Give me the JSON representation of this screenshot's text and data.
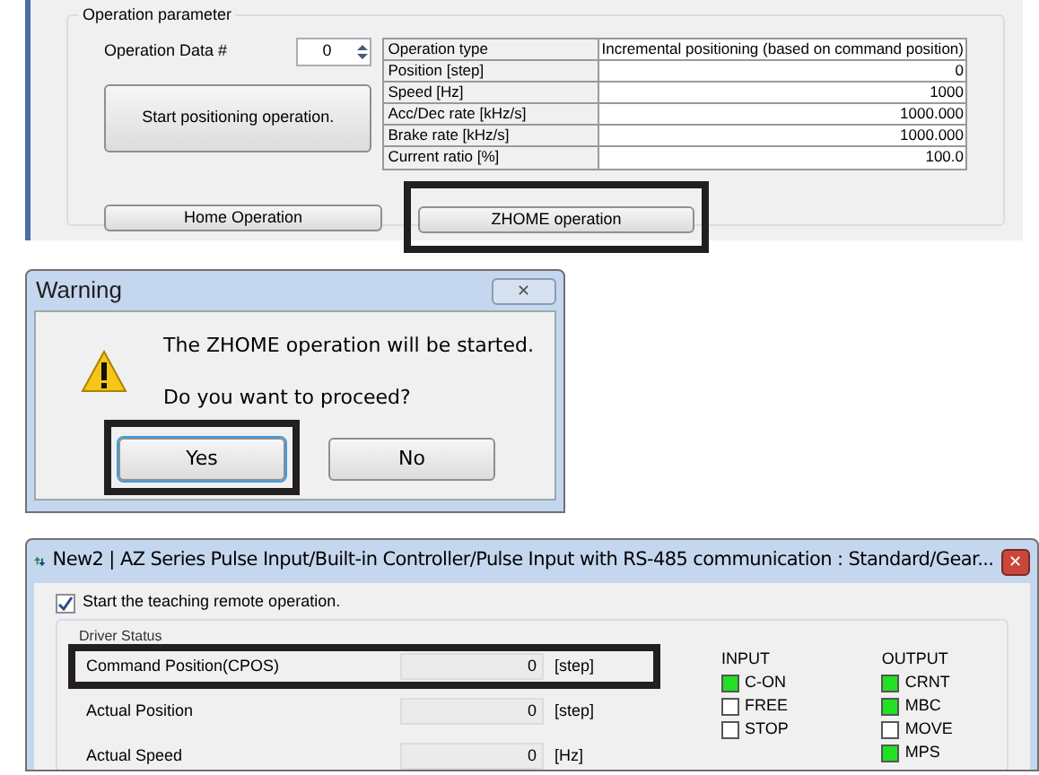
{
  "operation_panel": {
    "group_title": "Operation parameter",
    "data_label": "Operation Data #",
    "data_value": "0",
    "start_button": "Start positioning operation.",
    "home_button": "Home Operation",
    "zhome_button": "ZHOME operation",
    "zhome_highlighted": true,
    "params": [
      {
        "name": "Operation type",
        "value": "Incremental positioning (based on command position)"
      },
      {
        "name": "Position [step]",
        "value": "0"
      },
      {
        "name": "Speed [Hz]",
        "value": "1000"
      },
      {
        "name": "Acc/Dec rate [kHz/s]",
        "value": "1000.000"
      },
      {
        "name": "Brake rate [kHz/s]",
        "value": "1000.000"
      },
      {
        "name": "Current ratio [%]",
        "value": "100.0"
      }
    ]
  },
  "warning_dialog": {
    "title": "Warning",
    "message": "The ZHOME operation will be started.",
    "question": "Do you want to proceed?",
    "close": "✕",
    "buttons": [
      {
        "label": "Yes",
        "selected": true,
        "highlighted": true
      },
      {
        "label": "No",
        "selected": false,
        "highlighted": false
      }
    ]
  },
  "teaching_window": {
    "title": "New2 | AZ Series Pulse Input/Built-in Controller/Pulse Input with RS-485 communication : Standard/Gear...",
    "close": "✕",
    "remote_checkbox": {
      "label": "Start the teaching remote operation.",
      "checked": true
    },
    "group_title": "Driver Status",
    "fields": [
      {
        "label": "Command Position(CPOS)",
        "value": "0",
        "unit": "[step]",
        "highlighted": true
      },
      {
        "label": "Actual Position",
        "value": "0",
        "unit": "[step]",
        "highlighted": false
      },
      {
        "label": "Actual Speed",
        "value": "0",
        "unit": "[Hz]",
        "highlighted": false
      }
    ],
    "io": [
      {
        "title": "INPUT",
        "signals": [
          {
            "name": "C-ON",
            "on": true
          },
          {
            "name": "FREE",
            "on": false
          },
          {
            "name": "STOP",
            "on": false
          }
        ]
      },
      {
        "title": "OUTPUT",
        "signals": [
          {
            "name": "CRNT",
            "on": true
          },
          {
            "name": "MBC",
            "on": true
          },
          {
            "name": "MOVE",
            "on": false
          },
          {
            "name": "MPS",
            "on": true
          }
        ]
      }
    ]
  }
}
